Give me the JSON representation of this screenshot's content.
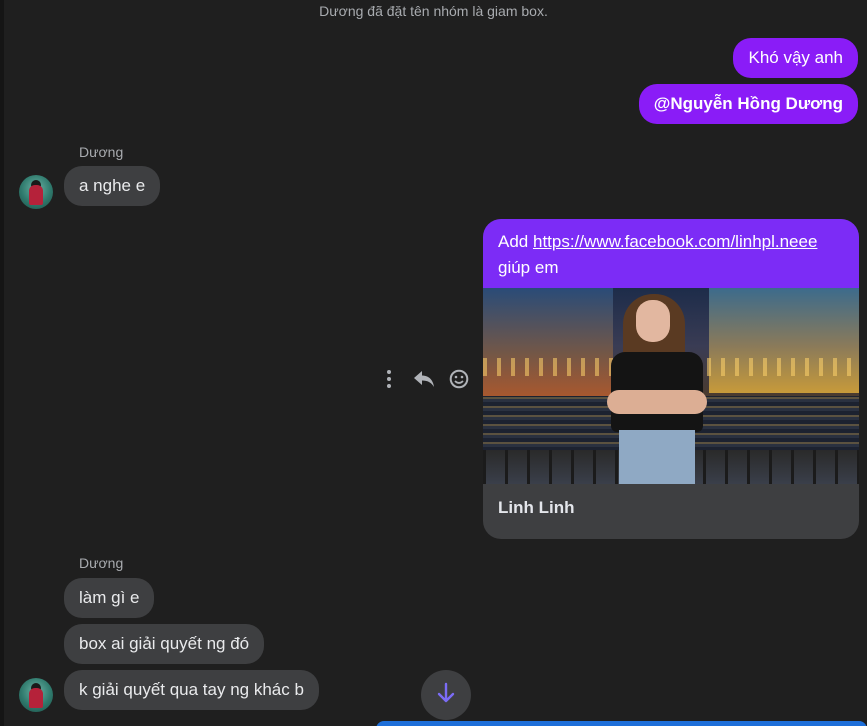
{
  "system_note": "Dương đã đặt tên nhóm là giam box.",
  "messages": {
    "out_1": "Khó vậy anh",
    "out_2": "@Nguyễn Hồng Dương",
    "sender_1": "Dương",
    "in_1": "a nghe e",
    "link_share": {
      "prefix": "Add ",
      "url": "https://www.facebook.com/linhpl.neee",
      "suffix": "giúp em",
      "preview_title": "Linh Linh"
    },
    "sender_2": "Dương",
    "in_2": "làm gì e",
    "in_3": "box ai giải quyết ng đó",
    "in_4": "k giải quyết qua tay ng khác b"
  },
  "icons": {
    "more": "more-options-icon",
    "reply": "reply-icon",
    "react": "emoji-react-icon",
    "scroll": "arrow-down-icon"
  },
  "colors": {
    "outgoing": "#8a1cf7",
    "incoming": "#3e3f41",
    "background": "#1f1f1f",
    "scroll_arrow": "#7b6cf6"
  }
}
